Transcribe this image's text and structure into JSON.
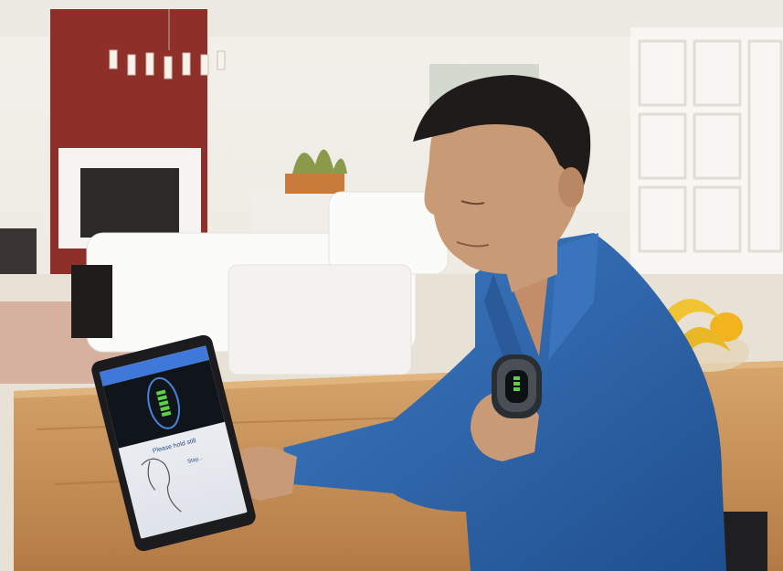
{
  "scene": {
    "subject": "man-using-tablet-with-chest-device",
    "colors": {
      "wall": "#f2efea",
      "accent_wall": "#8f2f2a",
      "table_wood": "#c8935a",
      "shirt": "#2d63a8",
      "skin": "#c99a76",
      "hair": "#1e1b1a",
      "tablet_frame": "#1c1c1e",
      "tablet_header": "#3f78d8",
      "battery_green": "#5fcf4a",
      "fruit_yellow": "#f1c232"
    }
  },
  "tablet": {
    "prompt_text": "Please hold still",
    "sub_text": "Stay...",
    "level_bars": 5
  }
}
